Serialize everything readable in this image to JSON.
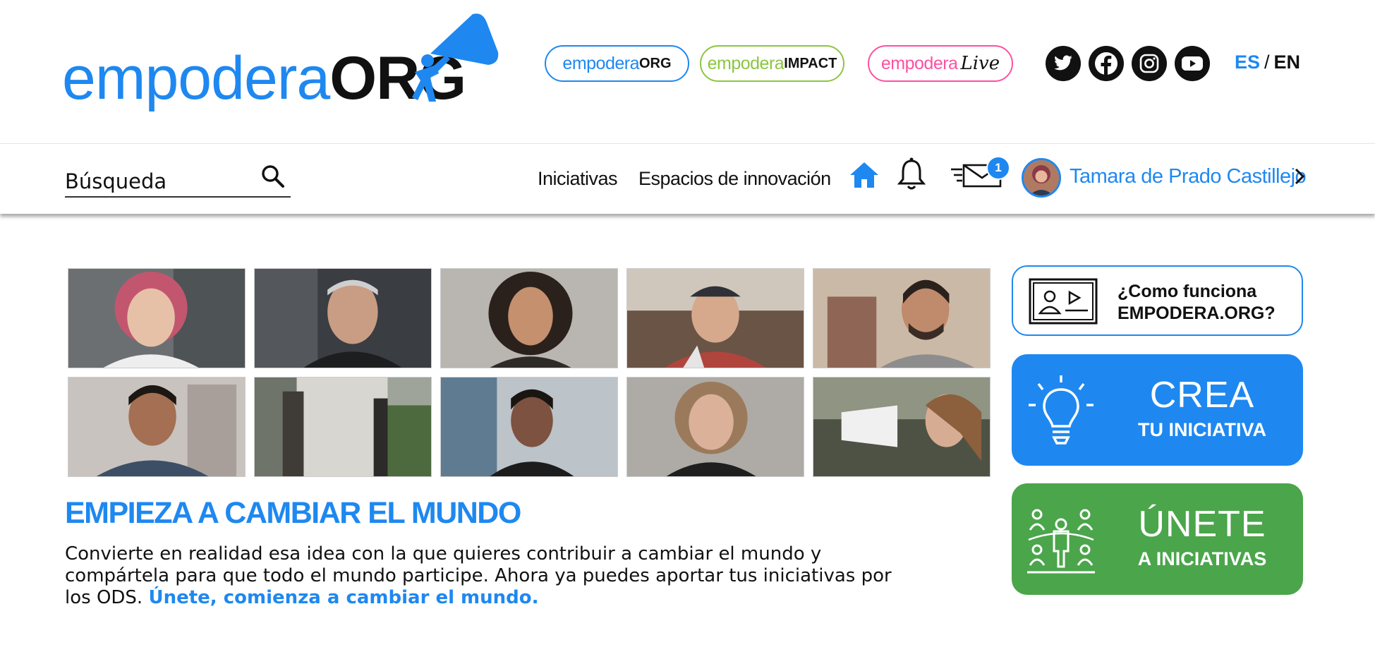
{
  "brand": {
    "logo_light": "empodera",
    "logo_bold": "ORG",
    "color_primary": "#1e88f0"
  },
  "platforms": [
    {
      "light": "empodera",
      "strong": "ORG",
      "color": "#1e88f0"
    },
    {
      "light": "empodera",
      "strong": "IMPACT",
      "color": "#8cc63f"
    },
    {
      "light": "empodera",
      "strong": "Live",
      "color": "#ff4fa3"
    }
  ],
  "social": [
    "twitter-icon",
    "facebook-icon",
    "instagram-icon",
    "youtube-icon"
  ],
  "language": {
    "active": "ES",
    "separator": "/",
    "other": "EN"
  },
  "search": {
    "placeholder": "Búsqueda"
  },
  "nav": {
    "items": [
      "Iniciativas",
      "Espacios de innovación"
    ],
    "messages_badge": "1",
    "user_name": "Tamara de Prado Castillejo"
  },
  "hero": {
    "headline": "EMPIEZA A CAMBIAR EL MUNDO",
    "body": "Convierte en realidad esa idea con la que quieres contribuir a cambiar el mundo y compártela para que todo el mundo participe. Ahora ya puedes aportar tus iniciativas por los ODS. ",
    "link": "Únete, comienza a cambiar el mundo."
  },
  "cards": {
    "how_line1": "¿Como funciona",
    "how_line2": "EMPODERA.ORG?",
    "crea_big": "CREA",
    "crea_small": "TU INICIATIVA",
    "crea_color": "#1e88f0",
    "unete_big": "ÚNETE",
    "unete_small": "A INICIATIVAS",
    "unete_color": "#4ba54b"
  }
}
